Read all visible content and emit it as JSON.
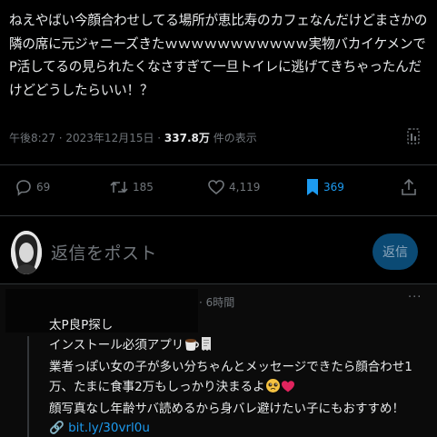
{
  "post": {
    "text": "ねえやばい今顔合わせしてる場所が恵比寿のカフェなんだけどまさかの隣の席に元ジャニーズきたｗｗｗｗｗｗｗｗｗｗｗ実物バカイケメンでP活してるの見られたくなさすぎて一旦トイレに逃げてきちゃったんだけどどうしたらいい！？"
  },
  "meta": {
    "datetime": "午後8:27 · 2023年12月15日 · ",
    "views_count": "337.8万",
    "views_label": " 件の表示"
  },
  "actions": {
    "replies": "69",
    "reposts": "185",
    "likes": "4,119",
    "bookmarks": "369"
  },
  "composer": {
    "placeholder": "返信をポスト",
    "button_label": "返信"
  },
  "reply": {
    "time": "· 6時間",
    "more": "···",
    "line1": "太P良P探し",
    "line2": "インストール必須アプリ",
    "line3": "業者っぽい女の子が多い分ちゃんとメッセージできたら顔合わせ1万、たまに食事2万もしっかり決まるよ",
    "line4": "顔写真なし年齢サバ読めるから身バレ避けたい子にもおすすめ！",
    "link": "bit.ly/30vrl0u"
  },
  "colors": {
    "background": "#000000",
    "text": "#e7e9ea",
    "muted": "#71767b",
    "accent": "#1d9bf0",
    "reply_button_bg": "#0b4a74"
  }
}
